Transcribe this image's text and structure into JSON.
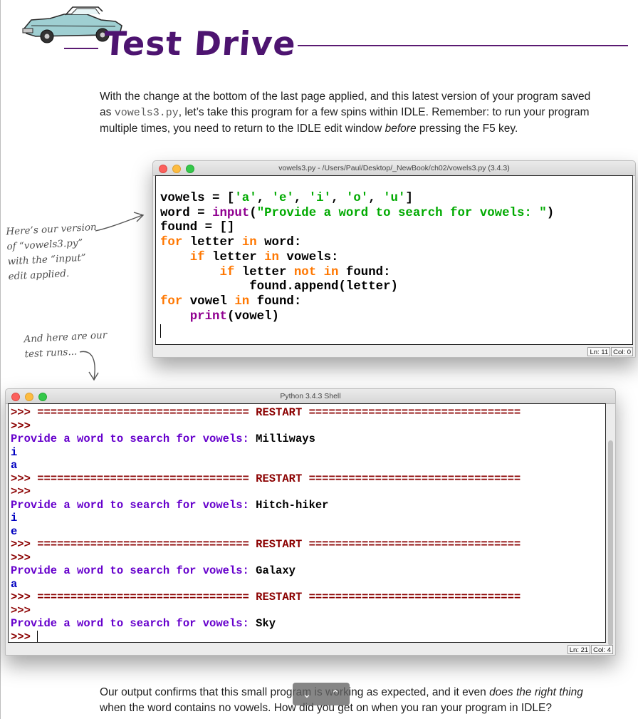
{
  "header": {
    "title": "Test Drive"
  },
  "intro": {
    "part1": "With the change at the bottom of the last page applied, and this latest version of your program saved as ",
    "filename": "vowels3.py",
    "part2": ", let’s take this program for a few spins within IDLE. Remember: to run your program multiple times, you need to return to the IDLE edit window ",
    "emphasis": "before",
    "part3": " pressing the F5 key."
  },
  "notes": {
    "note1": "Here’s our version of “vowels3.py” with the “input” edit applied.",
    "note2": "And here are our test runs..."
  },
  "editor_window": {
    "title": "vowels3.py - /Users/Paul/Desktop/_NewBook/ch02/vowels3.py (3.4.3)",
    "code": [
      [
        {
          "t": "vowels = [",
          "c": ""
        },
        {
          "t": "'a'",
          "c": "st"
        },
        {
          "t": ", ",
          "c": ""
        },
        {
          "t": "'e'",
          "c": "st"
        },
        {
          "t": ", ",
          "c": ""
        },
        {
          "t": "'i'",
          "c": "st"
        },
        {
          "t": ", ",
          "c": ""
        },
        {
          "t": "'o'",
          "c": "st"
        },
        {
          "t": ", ",
          "c": ""
        },
        {
          "t": "'u'",
          "c": "st"
        },
        {
          "t": "]",
          "c": ""
        }
      ],
      [
        {
          "t": "word = ",
          "c": ""
        },
        {
          "t": "input",
          "c": "bi"
        },
        {
          "t": "(",
          "c": ""
        },
        {
          "t": "\"Provide a word to search for vowels: \"",
          "c": "st"
        },
        {
          "t": ")",
          "c": ""
        }
      ],
      [
        {
          "t": "found = []",
          "c": ""
        }
      ],
      [
        {
          "t": "for",
          "c": "kw"
        },
        {
          "t": " letter ",
          "c": ""
        },
        {
          "t": "in",
          "c": "kw"
        },
        {
          "t": " word:",
          "c": ""
        }
      ],
      [
        {
          "t": "    ",
          "c": ""
        },
        {
          "t": "if",
          "c": "kw"
        },
        {
          "t": " letter ",
          "c": ""
        },
        {
          "t": "in",
          "c": "kw"
        },
        {
          "t": " vowels:",
          "c": ""
        }
      ],
      [
        {
          "t": "        ",
          "c": ""
        },
        {
          "t": "if",
          "c": "kw"
        },
        {
          "t": " letter ",
          "c": ""
        },
        {
          "t": "not",
          "c": "kw"
        },
        {
          "t": " ",
          "c": ""
        },
        {
          "t": "in",
          "c": "kw"
        },
        {
          "t": " found:",
          "c": ""
        }
      ],
      [
        {
          "t": "            found.append(letter)",
          "c": ""
        }
      ],
      [
        {
          "t": "for",
          "c": "kw"
        },
        {
          "t": " vowel ",
          "c": ""
        },
        {
          "t": "in",
          "c": "kw"
        },
        {
          "t": " found:",
          "c": ""
        }
      ],
      [
        {
          "t": "    ",
          "c": ""
        },
        {
          "t": "print",
          "c": "bi"
        },
        {
          "t": "(vowel)",
          "c": ""
        }
      ]
    ],
    "status_ln": "Ln: 11",
    "status_col": "Col: 0"
  },
  "shell_window": {
    "title": "Python 3.4.3 Shell",
    "lines": [
      {
        "type": "restart",
        "text": ">>> ================================ RESTART ================================"
      },
      {
        "type": "prompt",
        "text": ">>>"
      },
      {
        "type": "ask",
        "text": "Provide a word to search for vowels: ",
        "input": "Milliways"
      },
      {
        "type": "output",
        "text": "i"
      },
      {
        "type": "output",
        "text": "a"
      },
      {
        "type": "restart",
        "text": ">>> ================================ RESTART ================================"
      },
      {
        "type": "prompt",
        "text": ">>>"
      },
      {
        "type": "ask",
        "text": "Provide a word to search for vowels: ",
        "input": "Hitch-hiker"
      },
      {
        "type": "output",
        "text": "i"
      },
      {
        "type": "output",
        "text": "e"
      },
      {
        "type": "restart",
        "text": ">>> ================================ RESTART ================================"
      },
      {
        "type": "prompt",
        "text": ">>>"
      },
      {
        "type": "ask",
        "text": "Provide a word to search for vowels: ",
        "input": "Galaxy"
      },
      {
        "type": "output",
        "text": "a"
      },
      {
        "type": "restart",
        "text": ">>> ================================ RESTART ================================"
      },
      {
        "type": "prompt",
        "text": ">>>"
      },
      {
        "type": "ask",
        "text": "Provide a word to search for vowels: ",
        "input": "Sky"
      },
      {
        "type": "cursor",
        "text": ">>> "
      }
    ],
    "status_ln": "Ln: 21",
    "status_col": "Col: 4"
  },
  "outro": {
    "part1": "Our output confirms that this small program is working as expected, and it even ",
    "emphasis": "does the right thing",
    "part2": " when the word contains no vowels. How did you get on when you ran your program in IDLE?"
  },
  "nav": {
    "down_icon": "⌄",
    "up_icon": "⌃"
  },
  "colors": {
    "title": "#4d1470",
    "keyword": "#ff7700",
    "builtin": "#900090",
    "string": "#00aa00",
    "shell_output": "#0000c0",
    "shell_prompt": "#8b0000"
  }
}
